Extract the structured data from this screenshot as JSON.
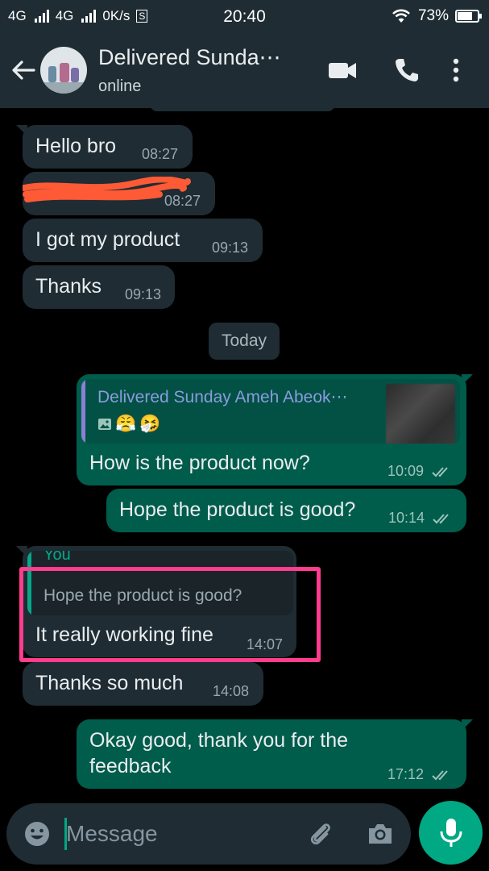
{
  "status_bar": {
    "network1": "4G",
    "network2": "4G",
    "speed": "0K/s",
    "sim_icon_label": "S",
    "time": "20:40",
    "battery_percent": "73%",
    "battery_level": 0.73
  },
  "header": {
    "title": "Delivered Sunda⋯",
    "status": "online",
    "icons": [
      "back-arrow-icon",
      "avatar",
      "video-call-icon",
      "phone-call-icon",
      "more-menu-icon"
    ]
  },
  "messages": [
    {
      "id": "m1",
      "dir": "in",
      "text": "Hello bro",
      "time": "08:27"
    },
    {
      "id": "m2",
      "dir": "in",
      "text": "",
      "time": "08:27",
      "redacted": true
    },
    {
      "id": "m3",
      "dir": "in",
      "text": "I got my product",
      "time": "09:13"
    },
    {
      "id": "m4",
      "dir": "in",
      "text": "Thanks",
      "time": "09:13"
    },
    {
      "id": "m5",
      "dir": "out",
      "quote_name": "Delivered Sunday Ameh  Abeok⋯",
      "quote_icons": [
        "image-icon",
        "😤",
        "🤧"
      ],
      "text": "How is the product now?",
      "time": "10:09"
    },
    {
      "id": "m6",
      "dir": "out",
      "text": "Hope the product is good?",
      "time": "10:14"
    },
    {
      "id": "m7",
      "dir": "in",
      "quote_name": "You",
      "quote_text": "Hope the product is good?",
      "text": "It really working fine",
      "time": "14:07"
    },
    {
      "id": "m8",
      "dir": "in",
      "text": "Thanks so much",
      "time": "14:08"
    },
    {
      "id": "m9",
      "dir": "out",
      "text_line1": "Okay good, thank you for the",
      "text_line2": "feedback",
      "time": "17:12"
    }
  ],
  "date_chip": "Today",
  "input": {
    "placeholder": "Message"
  },
  "colors": {
    "bar_bg": "#1f2c33",
    "incoming_bubble": "#1f2c33",
    "outgoing_bubble": "#005c4b",
    "accent": "#00a884",
    "highlight_box": "#ff3c8e",
    "redaction": "#ff5a36"
  }
}
